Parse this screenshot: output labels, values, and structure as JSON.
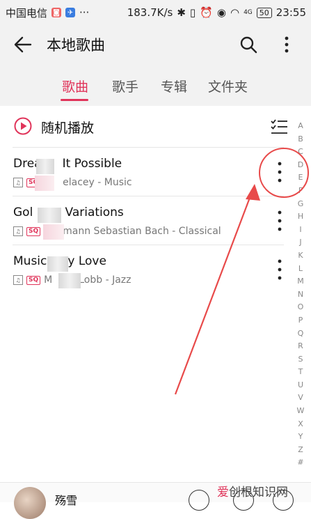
{
  "status_bar": {
    "carrier": "中国电信",
    "speed": "183.7K/s",
    "signal_label": "4G",
    "battery": "50",
    "time": "23:55"
  },
  "app_bar": {
    "title": "本地歌曲",
    "icons": [
      "back-arrow-icon",
      "search-icon",
      "more-vertical-icon"
    ]
  },
  "tabs": [
    {
      "label": "歌曲",
      "active": true
    },
    {
      "label": "歌手",
      "active": false
    },
    {
      "label": "专辑",
      "active": false
    },
    {
      "label": "文件夹",
      "active": false
    }
  ],
  "shuffle": {
    "label": "随机播放"
  },
  "songs": [
    {
      "title_a": "Drea",
      "title_b": "It Possible",
      "sub_a": "",
      "sub_b": "elacey - Music"
    },
    {
      "title_a": "Gol",
      "title_b": "g Variations",
      "sub_a": "",
      "sub_b": "mann Sebastian Bach - Classical"
    },
    {
      "title_a": "Music",
      "title_b": "y Love",
      "sub_a": "M",
      "sub_b": "Lobb - Jazz"
    }
  ],
  "badges": {
    "quality_small": "♫",
    "sq": "SQ"
  },
  "index_letters": [
    "A",
    "B",
    "C",
    "D",
    "E",
    "F",
    "G",
    "H",
    "I",
    "J",
    "K",
    "L",
    "M",
    "N",
    "O",
    "P",
    "Q",
    "R",
    "S",
    "T",
    "U",
    "V",
    "W",
    "X",
    "Y",
    "Z",
    "#"
  ],
  "now_playing": {
    "title": "殇雪"
  },
  "watermark": {
    "part1": "爱",
    "part2": "创根知识网"
  },
  "colors": {
    "accent": "#e0345a",
    "annotation": "#e84a4a"
  }
}
